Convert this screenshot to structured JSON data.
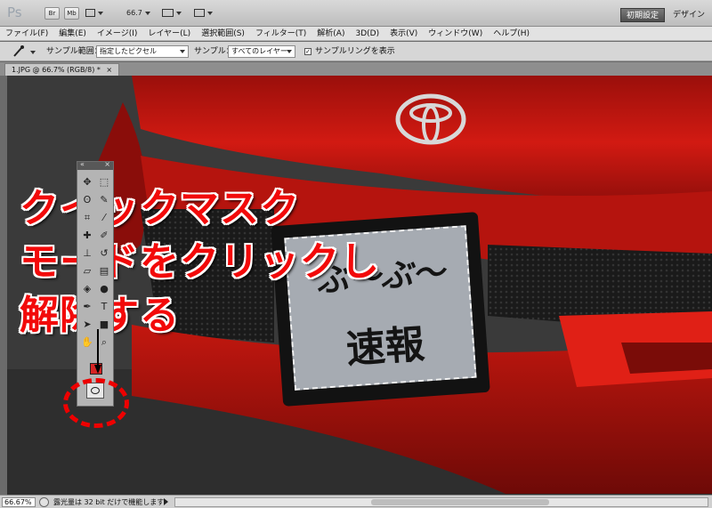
{
  "app": {
    "logo": "Ps",
    "bridge_label": "Br",
    "minibridge_label": "Mb",
    "zoom_value": "66.7",
    "workspace_active": "初期設定",
    "workspace_other": "デザイン"
  },
  "menu": [
    "ファイル(F)",
    "編集(E)",
    "イメージ(I)",
    "レイヤー(L)",
    "選択範囲(S)",
    "フィルター(T)",
    "解析(A)",
    "3D(D)",
    "表示(V)",
    "ウィンドウ(W)",
    "ヘルプ(H)"
  ],
  "options": {
    "sample_size_label": "サンプル範囲：",
    "sample_size_value": "指定したピクセル",
    "sample_label": "サンプル：",
    "sample_value": "すべてのレイヤー",
    "show_ring_label": "サンプルリングを表示",
    "show_ring_checked": "✓"
  },
  "document": {
    "tab_title": "1.JPG @ 66.7% (RGB/8) *",
    "tab_close": "×"
  },
  "plate": {
    "line1": "ぶ〜ぶ〜",
    "line2": "速報"
  },
  "annotation": {
    "line1": "クイックマスク",
    "line2": "モードをクリックし",
    "line3": "解除する"
  },
  "tools_panel": {
    "close": "×",
    "collapse": "«"
  },
  "status": {
    "zoom": "66.67%",
    "message": "露光量は 32 bit だけで機能します"
  },
  "colors": {
    "accent_red": "#f20a0a",
    "car_red": "#b3120d",
    "foreground_swatch": "#d62424"
  }
}
